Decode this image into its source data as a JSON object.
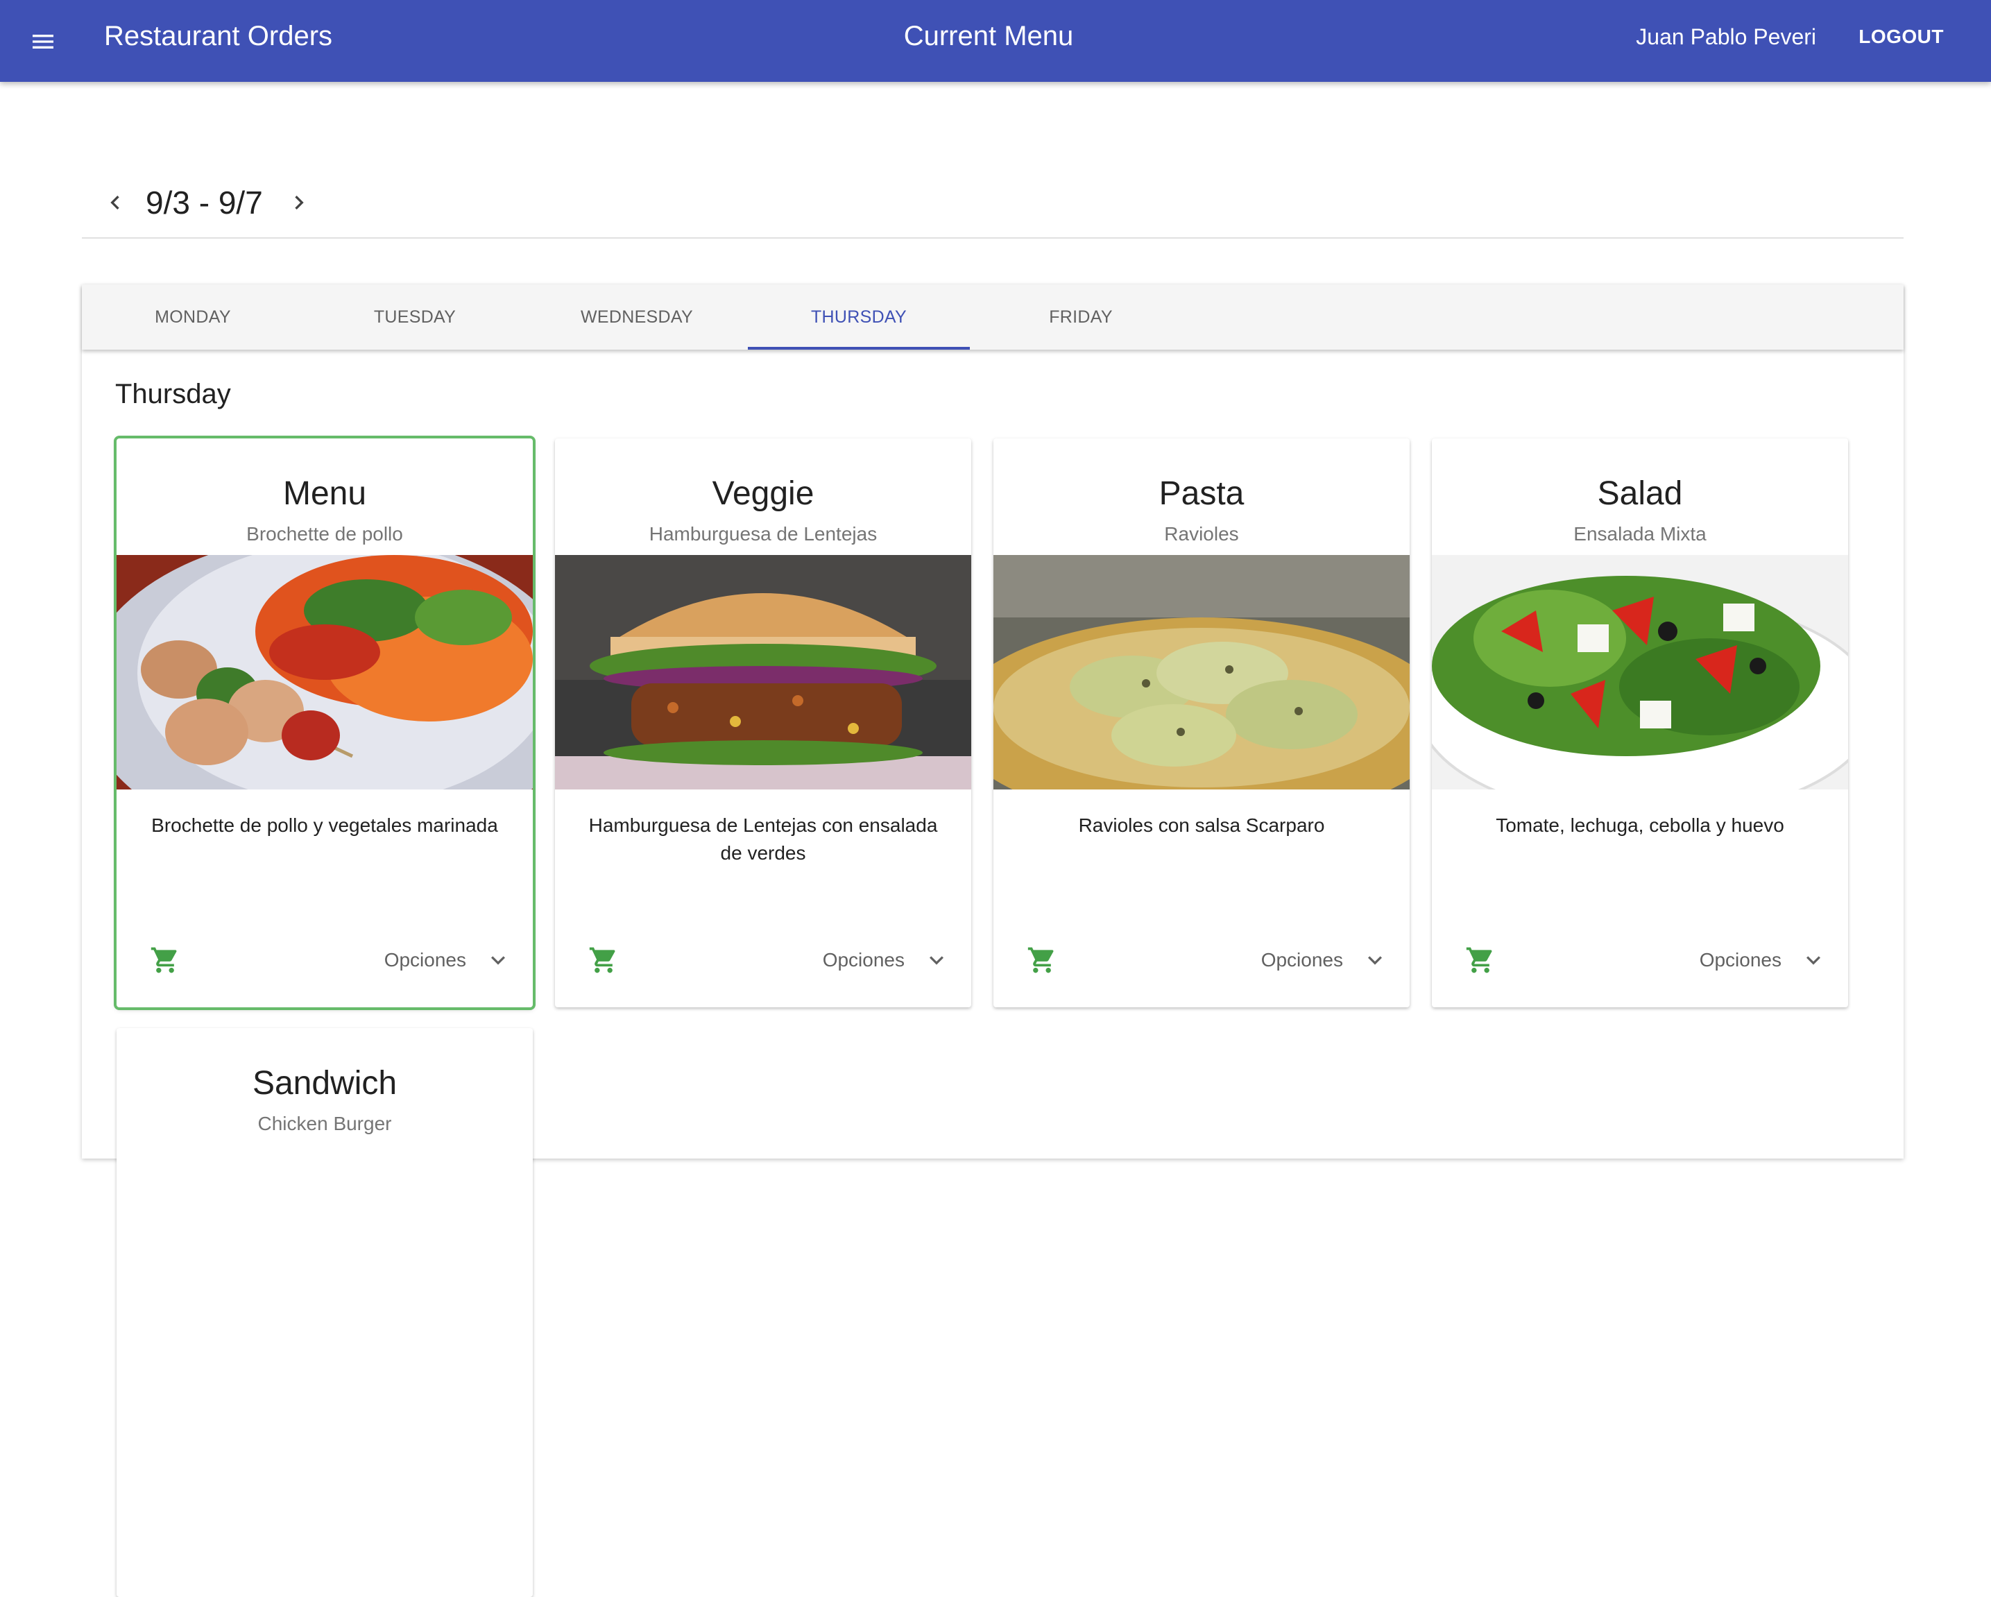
{
  "header": {
    "app_title": "Restaurant Orders",
    "page_title": "Current Menu",
    "user_name": "Juan Pablo Peveri",
    "logout_label": "LOGOUT",
    "background_color": "#3f51b5"
  },
  "week": {
    "label": "9/3 - 9/7"
  },
  "tabs": [
    {
      "label": "MONDAY",
      "active": false
    },
    {
      "label": "TUESDAY",
      "active": false
    },
    {
      "label": "WEDNESDAY",
      "active": false
    },
    {
      "label": "THURSDAY",
      "active": true
    },
    {
      "label": "FRIDAY",
      "active": false
    }
  ],
  "day_heading": "Thursday",
  "cards": [
    {
      "title": "Menu",
      "subtitle": "Brochette de pollo",
      "description": "Brochette de pollo y vegetales marinada",
      "options_label": "Opciones",
      "selected": true
    },
    {
      "title": "Veggie",
      "subtitle": "Hamburguesa de Lentejas",
      "description": "Hamburguesa de Lentejas con ensalada de verdes",
      "options_label": "Opciones",
      "selected": false
    },
    {
      "title": "Pasta",
      "subtitle": "Ravioles",
      "description": "Ravioles con salsa Scarparo",
      "options_label": "Opciones",
      "selected": false
    },
    {
      "title": "Salad",
      "subtitle": "Ensalada Mixta",
      "description": "Tomate, lechuga, cebolla y huevo",
      "options_label": "Opciones",
      "selected": false
    },
    {
      "title": "Sandwich",
      "subtitle": "Chicken Burger",
      "description": "",
      "options_label": "",
      "selected": false
    }
  ],
  "colors": {
    "primary": "#3f51b5",
    "cart_icon": "#43a047",
    "selected_outline": "#66bb6a"
  },
  "icons": {
    "menu": "hamburger-menu-icon",
    "prev": "chevron-left-icon",
    "next": "chevron-right-icon",
    "cart": "shopping-cart-icon",
    "expand": "chevron-down-icon"
  }
}
